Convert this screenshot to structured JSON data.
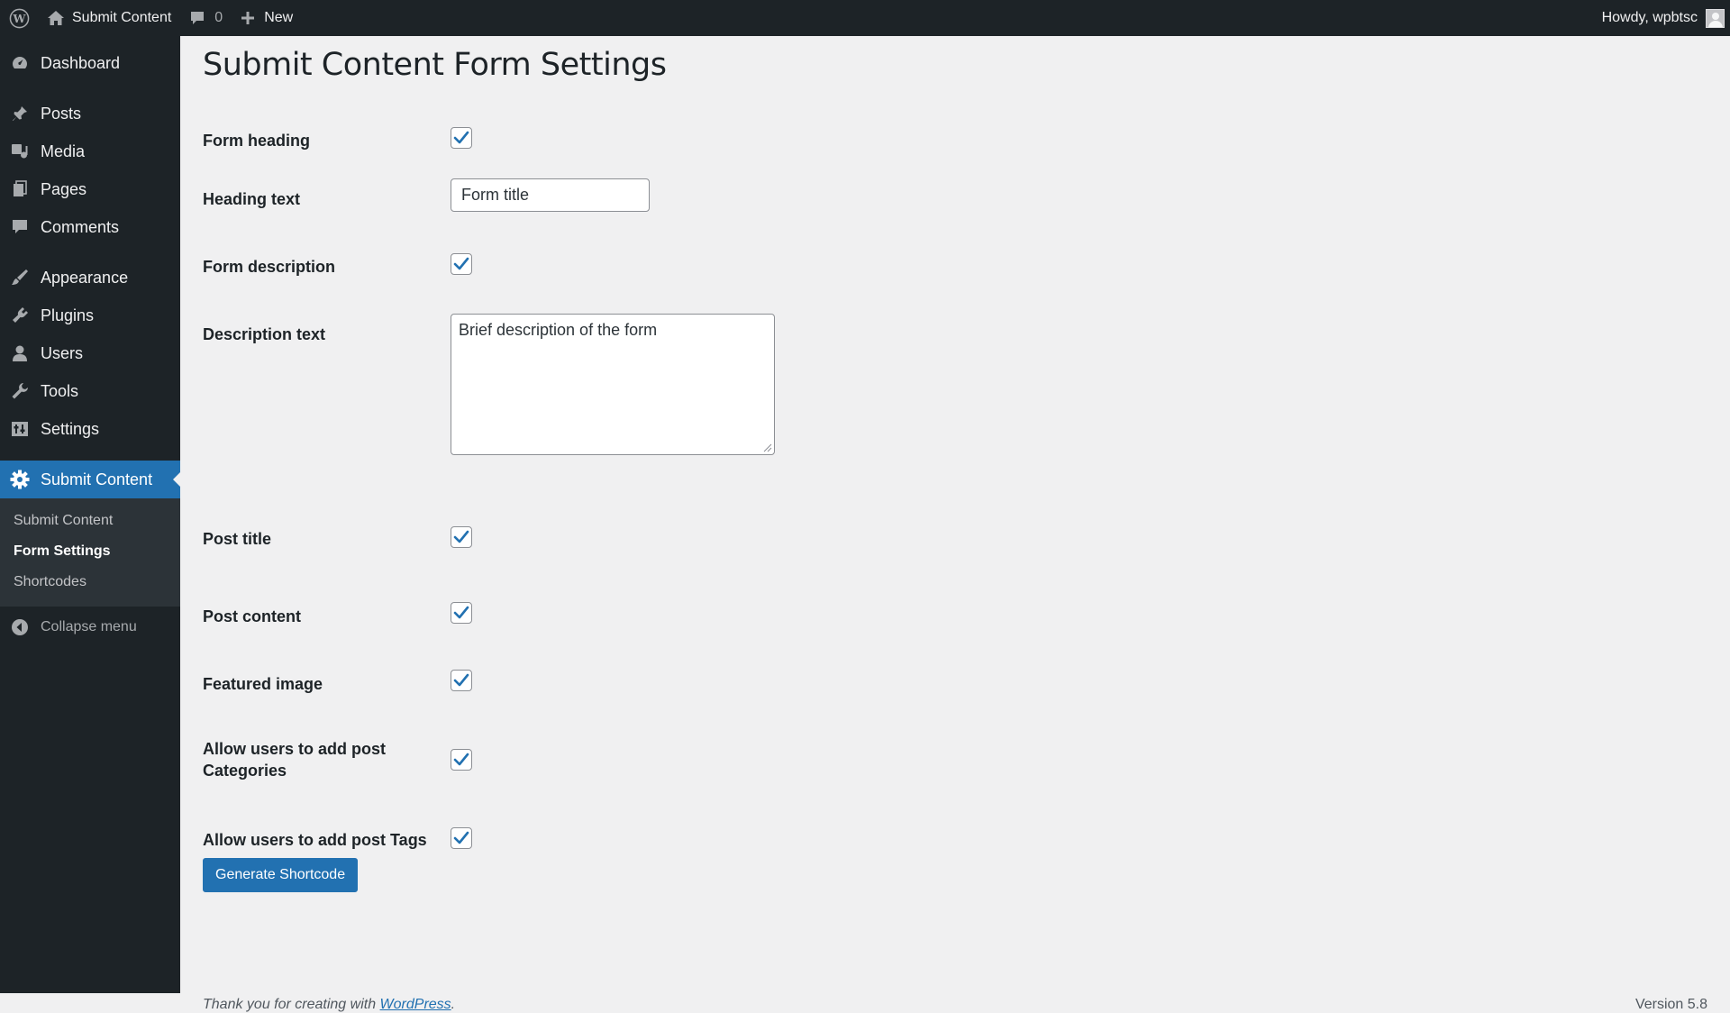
{
  "adminbar": {
    "site_name": "Submit Content",
    "comments_count": "0",
    "new_label": "New",
    "greeting": "Howdy, wpbtsc"
  },
  "menu": {
    "items": [
      {
        "label": "Dashboard",
        "icon": "dashboard-icon"
      },
      {
        "label": "Posts",
        "icon": "pushpin-icon"
      },
      {
        "label": "Media",
        "icon": "media-icon"
      },
      {
        "label": "Pages",
        "icon": "pages-icon"
      },
      {
        "label": "Comments",
        "icon": "comment-icon"
      },
      {
        "label": "Appearance",
        "icon": "paintbrush-icon"
      },
      {
        "label": "Plugins",
        "icon": "plugin-icon"
      },
      {
        "label": "Users",
        "icon": "users-icon"
      },
      {
        "label": "Tools",
        "icon": "wrench-icon"
      },
      {
        "label": "Settings",
        "icon": "settings-icon"
      },
      {
        "label": "Submit Content",
        "icon": "gear-icon"
      }
    ],
    "submenu": [
      "Submit Content",
      "Form Settings",
      "Shortcodes"
    ],
    "collapse_label": "Collapse menu"
  },
  "page": {
    "title": "Submit Content Form Settings",
    "fields": {
      "form_heading": {
        "label": "Form heading",
        "checked": true
      },
      "heading_text": {
        "label": "Heading text",
        "value": "Form title"
      },
      "form_description": {
        "label": "Form description",
        "checked": true
      },
      "description_text": {
        "label": "Description text",
        "value": "Brief description of the form"
      },
      "post_title": {
        "label": "Post title",
        "checked": true
      },
      "post_content": {
        "label": "Post content",
        "checked": true
      },
      "featured_image": {
        "label": "Featured image",
        "checked": true
      },
      "allow_categories": {
        "label_line1": "Allow users to add post",
        "label_line2": "Categories",
        "checked": true
      },
      "allow_tags": {
        "label": "Allow users to add post Tags",
        "checked": true
      }
    },
    "generate_button": "Generate Shortcode"
  },
  "footer": {
    "thanks_prefix": "Thank you for creating with ",
    "thanks_link": "WordPress",
    "thanks_suffix": ".",
    "version": "Version 5.8"
  },
  "colors": {
    "accent": "#2271b1",
    "menu_bg": "#1d2327",
    "submenu_bg": "#2c3338",
    "page_bg": "#f0f0f1"
  }
}
